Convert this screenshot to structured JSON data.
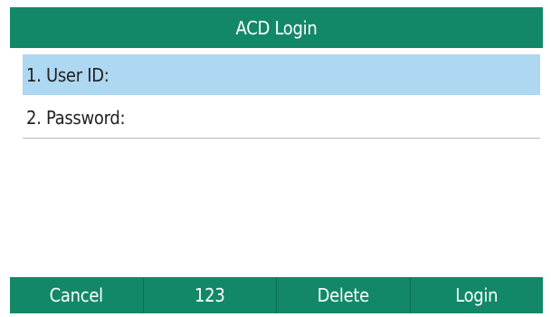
{
  "title": "ACD Login",
  "fields": [
    {
      "label": "1. User ID:",
      "value": ""
    },
    {
      "label": "2. Password:",
      "value": ""
    }
  ],
  "softkeys": [
    "Cancel",
    "123",
    "Delete",
    "Login"
  ],
  "colors": {
    "header": "#138868",
    "selection": "#aed7f2",
    "softkey_bar": "#138868"
  }
}
